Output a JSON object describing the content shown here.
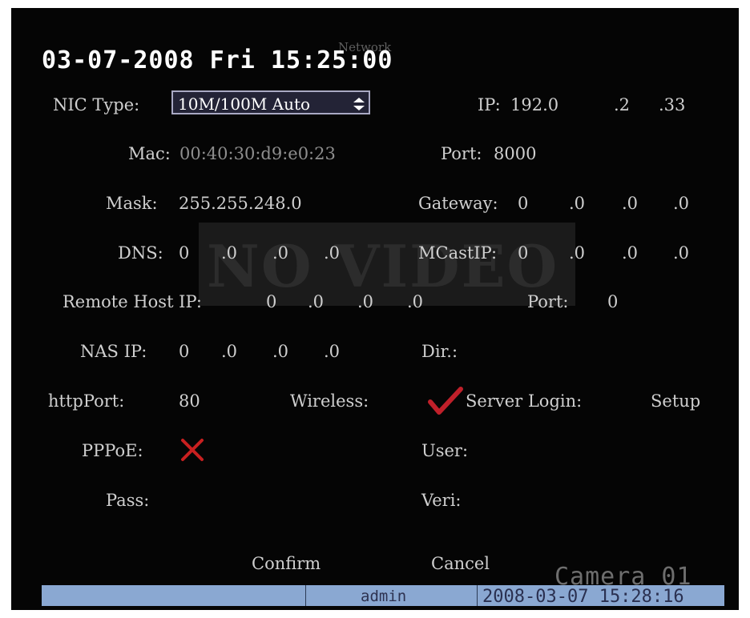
{
  "screen": {
    "menu_title": "Network",
    "datetime": "03-07-2008 Fri 15:25:00",
    "no_video": "NO VIDEO",
    "camera_label": "Camera 01"
  },
  "form": {
    "nic_type": {
      "label": "NIC Type:",
      "value": "10M/100M Auto"
    },
    "ip": {
      "label": "IP:",
      "octets": [
        "192.0",
        ".2",
        ".33"
      ]
    },
    "mac": {
      "label": "Mac:",
      "value": "00:40:30:d9:e0:23"
    },
    "port": {
      "label": "Port:",
      "value": "8000"
    },
    "mask": {
      "label": "Mask:",
      "value": "255.255.248.0"
    },
    "gateway": {
      "label": "Gateway:",
      "octets": [
        "0",
        ".0",
        ".0",
        ".0"
      ]
    },
    "dns": {
      "label": "DNS:",
      "octets": [
        "0",
        ".0",
        ".0",
        ".0"
      ]
    },
    "mcast_ip": {
      "label": "MCastIP:",
      "octets": [
        "0",
        ".0",
        ".0",
        ".0"
      ]
    },
    "remote_host_ip": {
      "label": "Remote Host IP:",
      "octets": [
        "0",
        ".0",
        ".0",
        ".0"
      ]
    },
    "remote_port": {
      "label": "Port:",
      "value": "0"
    },
    "nas_ip": {
      "label": "NAS IP:",
      "octets": [
        "0",
        ".0",
        ".0",
        ".0"
      ]
    },
    "dir": {
      "label": "Dir.:",
      "value": ""
    },
    "http_port": {
      "label": "httpPort:",
      "value": "80"
    },
    "wireless": {
      "label": "Wireless:",
      "checked": true
    },
    "server_login": {
      "label": "Server Login:",
      "value": "Setup"
    },
    "pppoe": {
      "label": "PPPoE:",
      "checked": false
    },
    "user": {
      "label": "User:",
      "value": ""
    },
    "pass": {
      "label": "Pass:",
      "value": ""
    },
    "veri": {
      "label": "Veri:",
      "value": ""
    }
  },
  "buttons": {
    "confirm": "Confirm",
    "cancel": "Cancel"
  },
  "statusbar": {
    "user": "admin",
    "datetime": "2008-03-07 15:28:16"
  },
  "colors": {
    "check": "#c0202a",
    "cross": "#c82020",
    "status_bg": "#8aa8d2",
    "nic_box_bg": "#232336"
  },
  "icons": {
    "nic_spinner": "up-down-arrows-icon",
    "wireless": "check-icon",
    "pppoe": "cross-icon"
  }
}
